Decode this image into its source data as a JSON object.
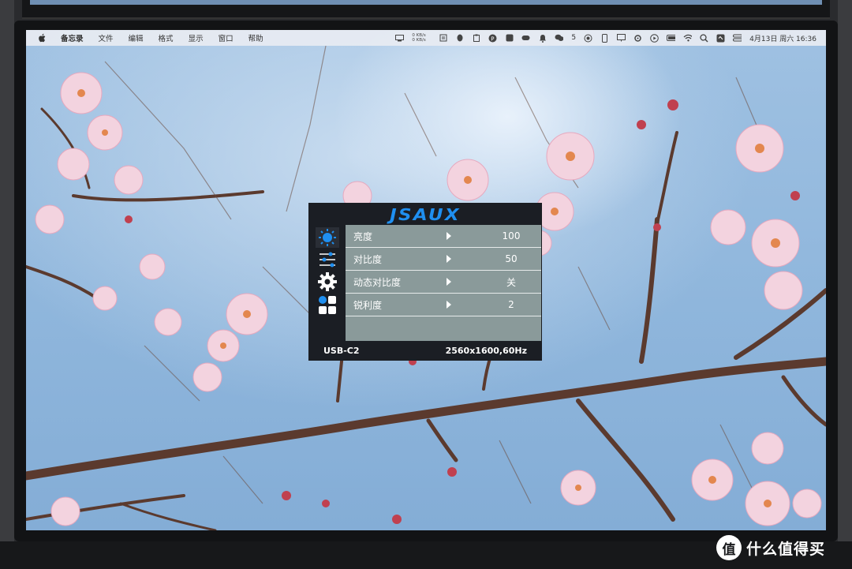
{
  "menubar": {
    "app_name": "备忘录",
    "items": [
      "文件",
      "编辑",
      "格式",
      "显示",
      "窗口",
      "帮助"
    ],
    "network_speed": [
      "0 KB/s",
      "0 KB/s"
    ],
    "wechat_count": "5",
    "datetime": "4月13日 周六  16:36"
  },
  "osd": {
    "brand": "JSAUX",
    "rows": [
      {
        "label": "亮度",
        "value": "100"
      },
      {
        "label": "对比度",
        "value": "50"
      },
      {
        "label": "动态对比度",
        "value": "关"
      },
      {
        "label": "锐利度",
        "value": "2"
      }
    ],
    "input_source": "USB-C2",
    "resolution": "2560x1600,60Hz",
    "accent_color": "#1f8ff0"
  },
  "watermark": {
    "text": "什么值得买",
    "logo_glyph": "值"
  }
}
